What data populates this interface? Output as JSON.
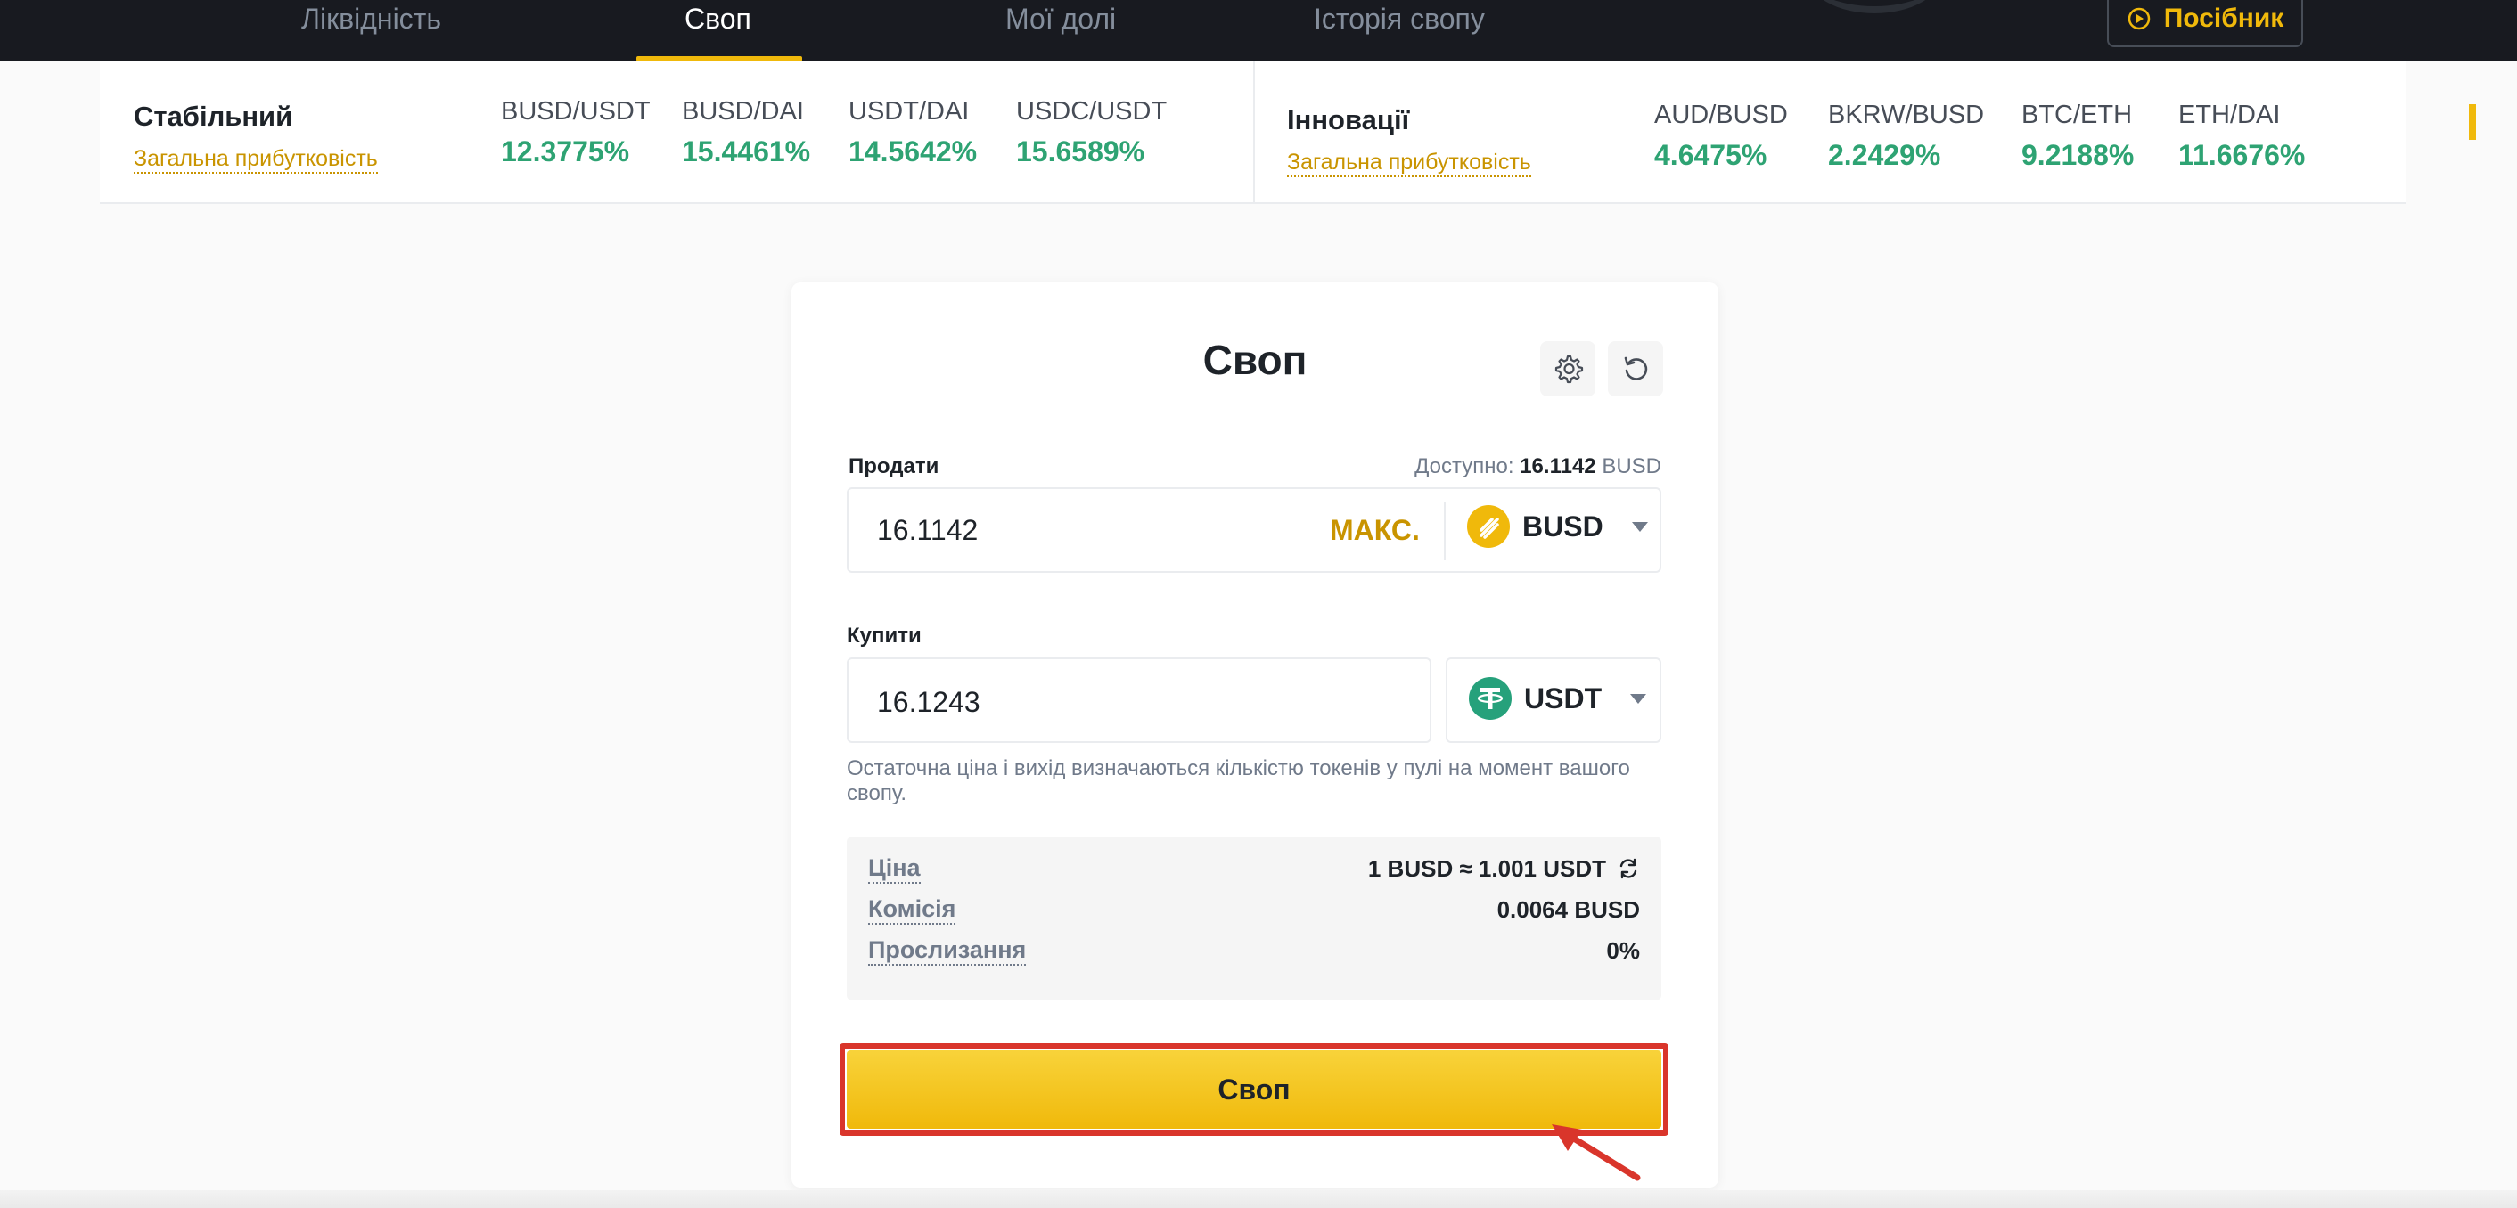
{
  "nav": {
    "tabs": [
      {
        "label": "Ліквідність"
      },
      {
        "label": "Своп",
        "active": true
      },
      {
        "label": "Мої долі"
      },
      {
        "label": "Історія свопу"
      }
    ],
    "guide_label": "Посібник"
  },
  "strip": {
    "stable": {
      "title": "Стабільний",
      "link": "Загальна прибутковість",
      "pairs": [
        {
          "name": "BUSD/USDT",
          "apy": "12.3775%"
        },
        {
          "name": "BUSD/DAI",
          "apy": "15.4461%"
        },
        {
          "name": "USDT/DAI",
          "apy": "14.5642%"
        },
        {
          "name": "USDC/USDT",
          "apy": "15.6589%"
        }
      ]
    },
    "innovation": {
      "title": "Інновації",
      "link": "Загальна прибутковість",
      "pairs": [
        {
          "name": "AUD/BUSD",
          "apy": "4.6475%"
        },
        {
          "name": "BKRW/BUSD",
          "apy": "2.2429%"
        },
        {
          "name": "BTC/ETH",
          "apy": "9.2188%"
        },
        {
          "name": "ETH/DAI",
          "apy": "11.6676%"
        }
      ]
    }
  },
  "card": {
    "title": "Своп",
    "sell": {
      "label": "Продати",
      "available_label": "Доступно:",
      "available_value": "16.1142",
      "available_unit": "BUSD",
      "value": "16.1142",
      "max_label": "МАКС.",
      "token": "BUSD"
    },
    "buy": {
      "label": "Купити",
      "value": "16.1243",
      "token": "USDT"
    },
    "note": "Остаточна ціна і вихід визначаються кількістю токенів у пулі на момент вашого свопу.",
    "info": {
      "price_label": "Ціна",
      "price_value": "1 BUSD ≈ 1.001 USDT",
      "fee_label": "Комісія",
      "fee_value": "0.0064 BUSD",
      "slippage_label": "Прослизання",
      "slippage_value": "0%"
    },
    "swap_button": "Своп"
  },
  "colors": {
    "brand_yellow": "#f0b90b",
    "positive_green": "#2ea373",
    "highlight_red": "#d9352b",
    "nav_bg": "#181a20"
  }
}
